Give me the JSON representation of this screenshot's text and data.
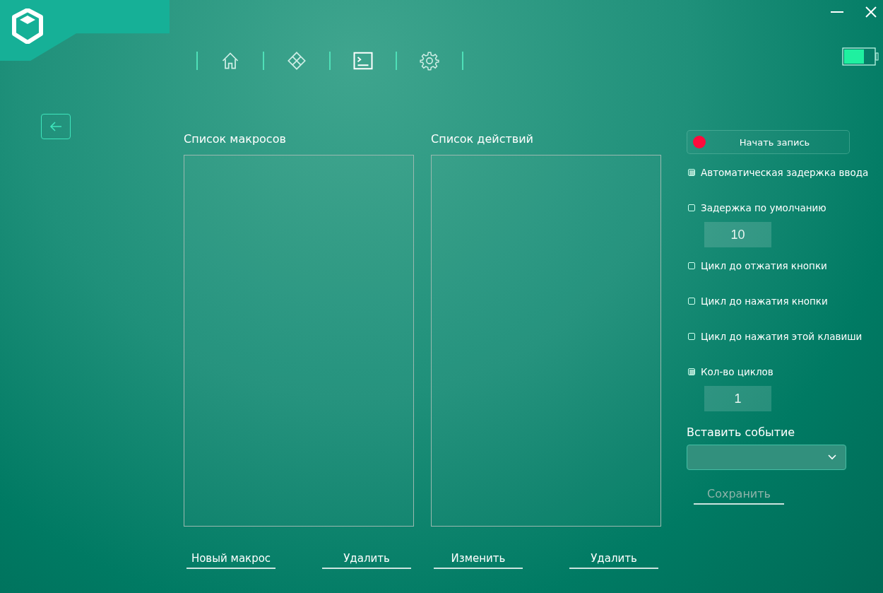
{
  "nav": [
    {
      "selected": false
    },
    {
      "selected": false
    },
    {
      "selected": true
    },
    {
      "selected": false
    }
  ],
  "lists": [
    {
      "title": "Список макросов",
      "buttons": [
        "Новый макрос",
        "Удалить"
      ]
    },
    {
      "title": "Список действий",
      "buttons": [
        "Изменить",
        "Удалить"
      ]
    }
  ],
  "record_button": "Начать запись",
  "options": [
    {
      "kind": "check",
      "label": "Автоматическая задержка ввода",
      "checked": true
    },
    {
      "kind": "check_input",
      "label": "Задержка по умолчанию",
      "checked": false,
      "value": "10"
    },
    {
      "kind": "check",
      "label": "Цикл до отжатия кнопки",
      "checked": false
    },
    {
      "kind": "check",
      "label": "Цикл до нажатия кнопки",
      "checked": false
    },
    {
      "kind": "check",
      "label": "Цикл до нажатия этой клавиши",
      "checked": false
    },
    {
      "kind": "check_input",
      "label": "Кол-во циклов",
      "checked": true,
      "value": "1"
    }
  ],
  "insert_event": {
    "label": "Вставить событие"
  },
  "save_button": {
    "label": "Сохранить",
    "disabled": true
  }
}
